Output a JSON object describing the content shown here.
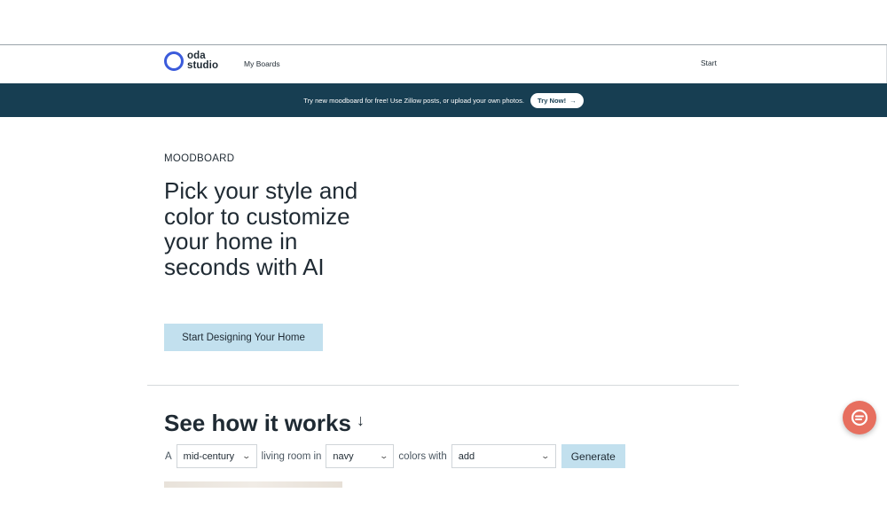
{
  "nav": {
    "logo_line1": "oda",
    "logo_line2": "studio",
    "my_boards": "My Boards",
    "start": "Start"
  },
  "banner": {
    "text": "Try new moodboard for free! Use Zillow posts, or upload your own photos.",
    "button_label": "Try Now!",
    "button_arrow": "→"
  },
  "hero": {
    "eyebrow": "MOODBOARD",
    "headline": "Pick your style and color to customize your home in seconds with AI",
    "cta": "Start Designing Your Home"
  },
  "how_it_works": {
    "title": "See how it works",
    "arrow": "↓",
    "word_a": "A",
    "style_value": "mid-century",
    "word_room": "living room in",
    "color_value": "navy",
    "word_colors": "colors with",
    "add_value": "add",
    "generate_label": "Generate",
    "chevron": "⌄"
  },
  "colors": {
    "brand_blue": "#3b5bdb",
    "banner_bg": "#173e52",
    "cta_bg": "#c2e0ee",
    "chat_bg": "#e76f5f"
  },
  "icons": {
    "chat": "chat-bubble-icon",
    "logo": "logo-ring-icon"
  }
}
